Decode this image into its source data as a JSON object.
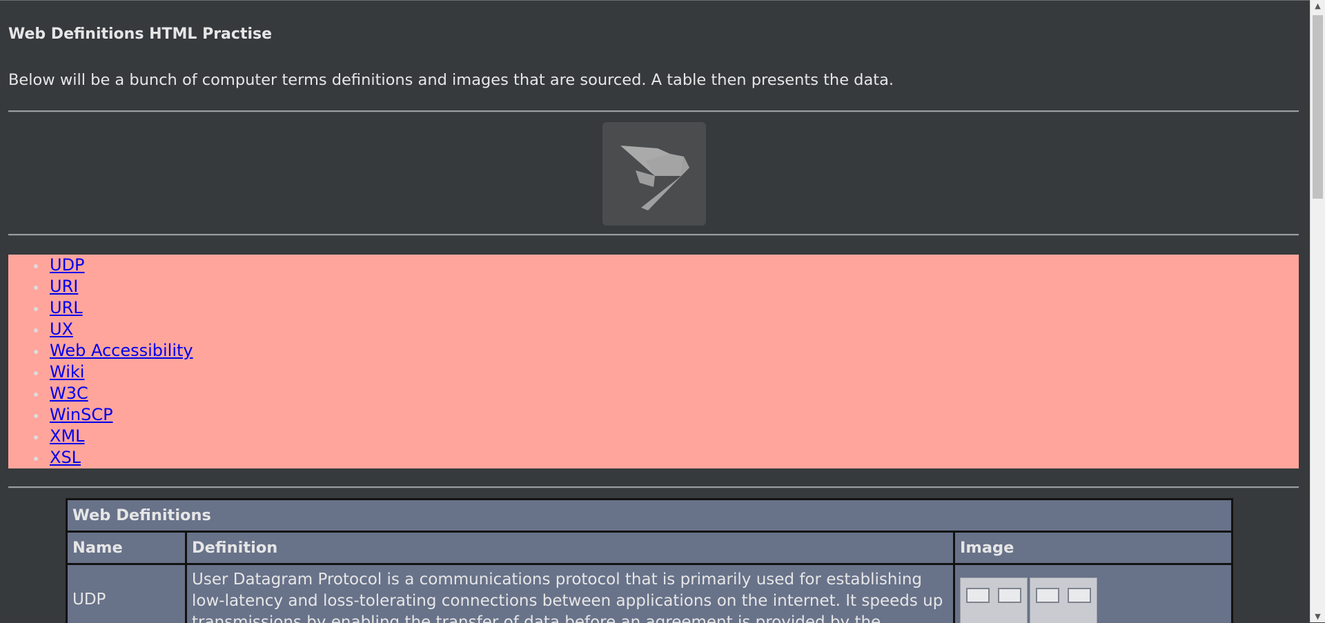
{
  "page": {
    "title": "Web Definitions HTML Practise",
    "intro": "Below will be a bunch of computer terms definitions and images that are sourced. A table then presents the data."
  },
  "logo": {
    "icon": "m-logo-icon"
  },
  "nav": {
    "items": [
      {
        "label": "UDP"
      },
      {
        "label": "URI"
      },
      {
        "label": "URL"
      },
      {
        "label": "UX"
      },
      {
        "label": "Web Accessibility"
      },
      {
        "label": "Wiki"
      },
      {
        "label": "W3C"
      },
      {
        "label": "WinSCP"
      },
      {
        "label": "XML"
      },
      {
        "label": "XSL"
      }
    ]
  },
  "table": {
    "caption": "Web Definitions",
    "headers": {
      "name": "Name",
      "definition": "Definition",
      "image": "Image"
    },
    "rows": [
      {
        "name": "UDP",
        "definition": "User Datagram Protocol is a communications protocol that is primarily used for establishing low-latency and loss-tolerating connections between applications on the internet. It speeds up transmissions by enabling the transfer of data before an agreement is provided by the",
        "image": "udp-diagram-image"
      }
    ]
  },
  "colors": {
    "background": "#363a3d",
    "nav_background": "#ffa59c",
    "link": "#0000ee",
    "table_background": "#687289",
    "text": "#e6e6e6"
  }
}
